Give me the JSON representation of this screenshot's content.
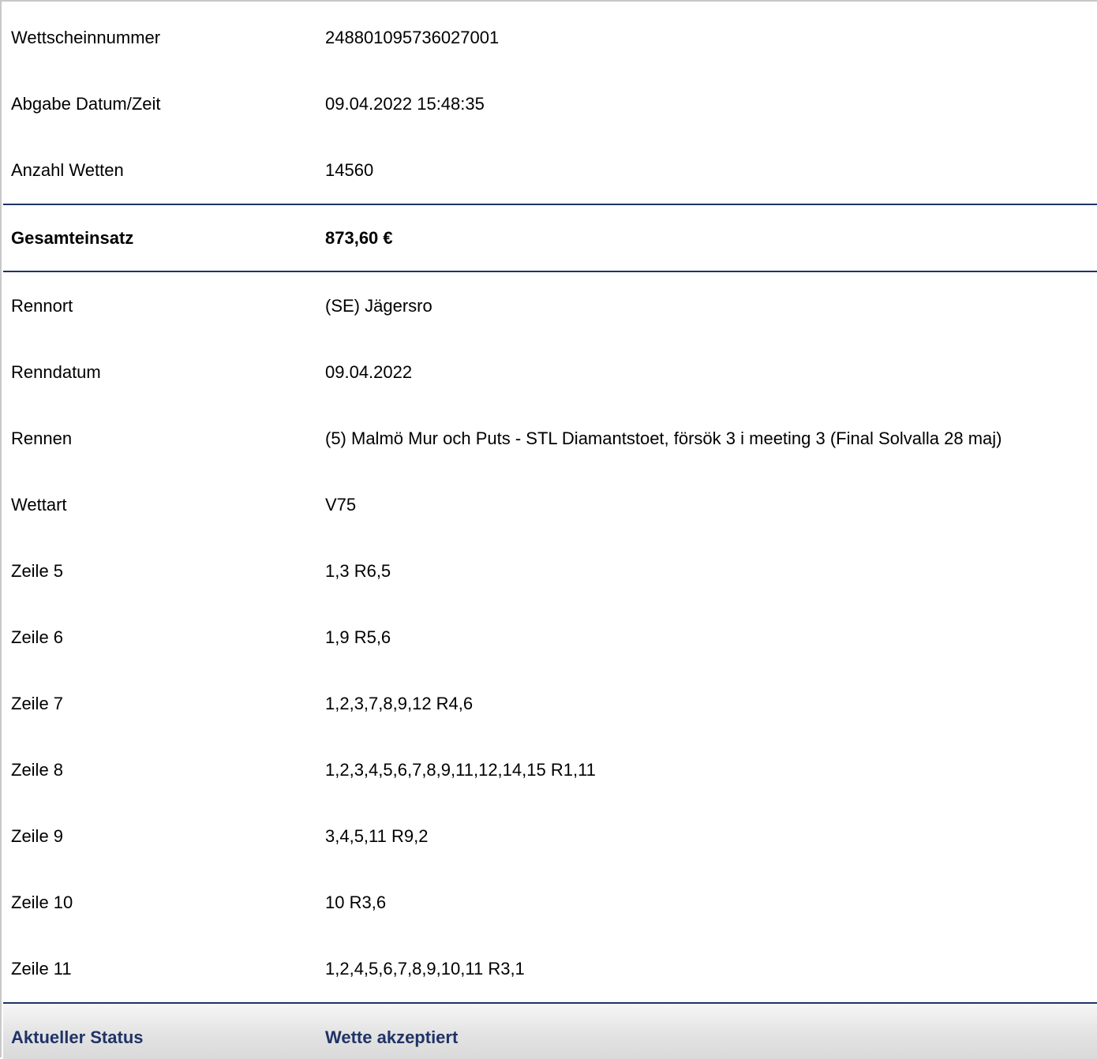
{
  "details": {
    "wettscheinnummer": {
      "label": "Wettscheinnummer",
      "value": "248801095736027001"
    },
    "abgabe": {
      "label": "Abgabe Datum/Zeit",
      "value": "09.04.2022 15:48:35"
    },
    "anzahl": {
      "label": "Anzahl Wetten",
      "value": "14560"
    }
  },
  "total": {
    "label": "Gesamteinsatz",
    "value": "873,60 €"
  },
  "race": {
    "rennort": {
      "label": "Rennort",
      "value": "(SE) Jägersro"
    },
    "renndatum": {
      "label": "Renndatum",
      "value": "09.04.2022"
    },
    "rennen": {
      "label": "Rennen",
      "value": "(5) Malmö Mur och Puts - STL Diamantstoet, försök 3 i meeting 3 (Final Solvalla 28 maj)"
    },
    "wettart": {
      "label": "Wettart",
      "value": "V75"
    }
  },
  "lines": [
    {
      "label": "Zeile 5",
      "value": "1,3 R6,5"
    },
    {
      "label": "Zeile 6",
      "value": "1,9 R5,6"
    },
    {
      "label": "Zeile 7",
      "value": "1,2,3,7,8,9,12 R4,6"
    },
    {
      "label": "Zeile 8",
      "value": "1,2,3,4,5,6,7,8,9,11,12,14,15 R1,11"
    },
    {
      "label": "Zeile 9",
      "value": "3,4,5,11 R9,2"
    },
    {
      "label": "Zeile 10",
      "value": "10 R3,6"
    },
    {
      "label": "Zeile 11",
      "value": "1,2,4,5,6,7,8,9,10,11 R3,1"
    }
  ],
  "status": {
    "label": "Aktueller Status",
    "value": "Wette akzeptiert"
  },
  "colors": {
    "accent": "#1f3366",
    "border": "#c8c8c8"
  }
}
